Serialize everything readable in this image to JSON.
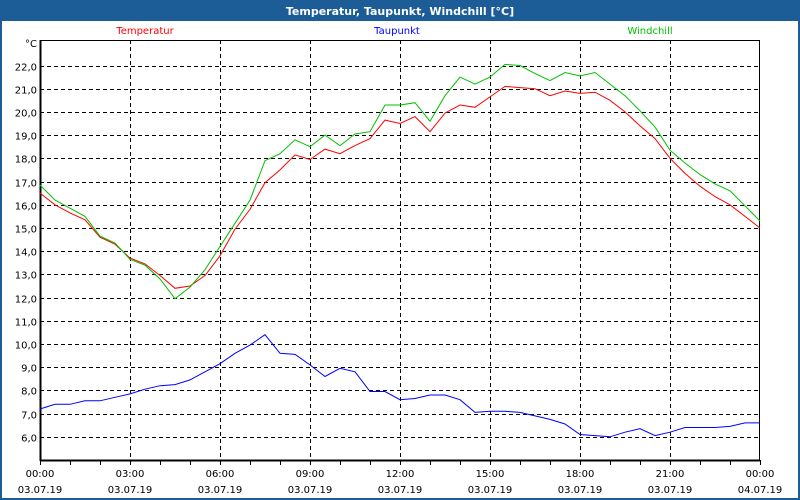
{
  "window": {
    "title": "Temperatur, Taupunkt, Windchill [°C]"
  },
  "chart_data": {
    "type": "line",
    "title": "Temperatur, Taupunkt, Windchill [°C]",
    "ylabel": "°C",
    "xlabel": "",
    "ylim": [
      5.0,
      23.1
    ],
    "xlim_hours": [
      0,
      24
    ],
    "grid": true,
    "legend_placement": "top",
    "y_ticks": [
      6,
      7,
      8,
      9,
      10,
      11,
      12,
      13,
      14,
      15,
      16,
      17,
      18,
      19,
      20,
      21,
      22
    ],
    "y_tick_labels": [
      "6,0",
      "7,0",
      "8,0",
      "9,0",
      "10,0",
      "11,0",
      "12,0",
      "13,0",
      "14,0",
      "15,0",
      "16,0",
      "17,0",
      "18,0",
      "19,0",
      "20,0",
      "21,0",
      "22,0"
    ],
    "x_ticks_hours": [
      0,
      3,
      6,
      9,
      12,
      15,
      18,
      21,
      24
    ],
    "x_tick_labels": [
      {
        "time": "00:00",
        "date": "03.07.19"
      },
      {
        "time": "03:00",
        "date": "03.07.19"
      },
      {
        "time": "06:00",
        "date": "03.07.19"
      },
      {
        "time": "09:00",
        "date": "03.07.19"
      },
      {
        "time": "12:00",
        "date": "03.07.19"
      },
      {
        "time": "15:00",
        "date": "03.07.19"
      },
      {
        "time": "18:00",
        "date": "03.07.19"
      },
      {
        "time": "21:00",
        "date": "03.07.19"
      },
      {
        "time": "00:00",
        "date": "04.07.19"
      }
    ],
    "x_step_hours": 0.5,
    "series": [
      {
        "name": "Temperatur",
        "color": "#ff0000",
        "values": [
          16.5,
          16.0,
          15.65,
          15.35,
          14.6,
          14.3,
          13.7,
          13.45,
          12.95,
          12.4,
          12.5,
          12.95,
          13.8,
          14.95,
          15.8,
          16.95,
          17.5,
          18.15,
          17.95,
          18.4,
          18.2,
          18.55,
          18.85,
          19.65,
          19.5,
          19.8,
          19.15,
          19.95,
          20.3,
          20.2,
          20.65,
          21.1,
          21.05,
          21.0,
          20.7,
          20.9,
          20.8,
          20.85,
          20.5,
          20.0,
          19.4,
          18.85,
          18.0,
          17.35,
          16.8,
          16.35,
          16.0,
          15.5,
          15.0
        ]
      },
      {
        "name": "Taupunkt",
        "color": "#0000ff",
        "values": [
          7.2,
          7.4,
          7.4,
          7.55,
          7.55,
          7.7,
          7.85,
          8.05,
          8.2,
          8.25,
          8.45,
          8.8,
          9.15,
          9.6,
          9.95,
          10.4,
          9.6,
          9.55,
          9.1,
          8.6,
          8.95,
          8.8,
          7.95,
          7.95,
          7.6,
          7.65,
          7.8,
          7.8,
          7.6,
          7.05,
          7.1,
          7.1,
          7.05,
          6.9,
          6.75,
          6.55,
          6.1,
          6.05,
          6.0,
          6.2,
          6.35,
          6.05,
          6.2,
          6.4,
          6.4,
          6.4,
          6.45,
          6.6,
          6.6
        ]
      },
      {
        "name": "Windchill",
        "color": "#00c000",
        "values": [
          16.85,
          16.2,
          15.85,
          15.5,
          14.65,
          14.35,
          13.65,
          13.4,
          12.8,
          11.95,
          12.45,
          13.2,
          14.2,
          15.2,
          16.2,
          17.9,
          18.2,
          18.8,
          18.5,
          19.0,
          18.55,
          19.05,
          19.15,
          20.3,
          20.3,
          20.4,
          19.6,
          20.7,
          21.5,
          21.2,
          21.5,
          22.05,
          22.0,
          21.65,
          21.35,
          21.7,
          21.55,
          21.7,
          21.2,
          20.7,
          20.05,
          19.35,
          18.35,
          17.8,
          17.3,
          16.9,
          16.6,
          15.95,
          15.3
        ]
      }
    ]
  }
}
